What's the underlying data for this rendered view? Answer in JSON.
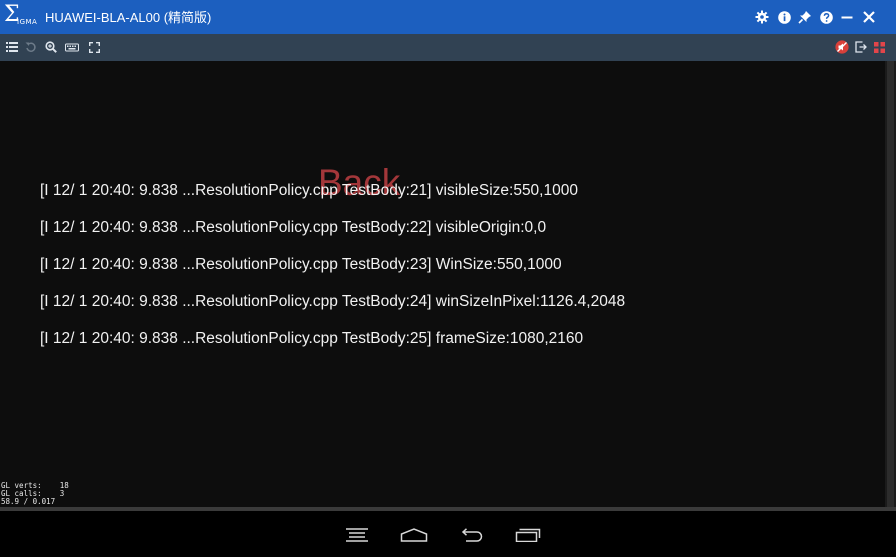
{
  "window": {
    "logo_text": "Σ",
    "logo_sub": "IGMA",
    "title": "HUAWEI-BLA-AL00 (精简版)"
  },
  "log_lines": [
    "[I 12/ 1 20:40: 9.838 ...ResolutionPolicy.cpp TestBody:21] visibleSize:550,1000",
    "[I 12/ 1 20:40: 9.838 ...ResolutionPolicy.cpp TestBody:22] visibleOrigin:0,0",
    "[I 12/ 1 20:40: 9.838 ...ResolutionPolicy.cpp TestBody:23] WinSize:550,1000",
    "[I 12/ 1 20:40: 9.838 ...ResolutionPolicy.cpp TestBody:24] winSizeInPixel:1126.4,2048",
    "[I 12/ 1 20:40: 9.838 ...ResolutionPolicy.cpp TestBody:25] frameSize:1080,2160"
  ],
  "back_label": "Back",
  "gl_stats": {
    "verts": "GL verts:    18",
    "calls": "GL calls:    3",
    "fps": "58.9 / 0.017"
  },
  "colors": {
    "titlebar": "#1c5fbf",
    "toolbar": "#314253",
    "screen": "#0d0d0d",
    "back_text": "#a3373a"
  }
}
